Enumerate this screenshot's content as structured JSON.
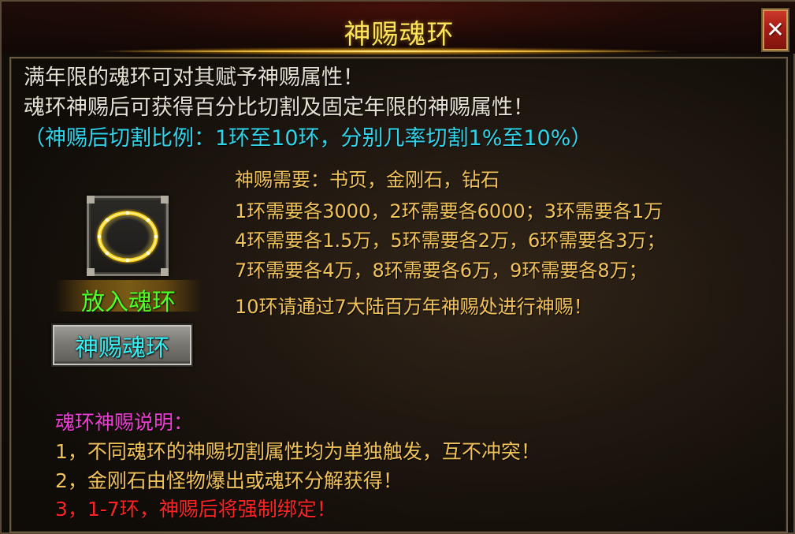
{
  "window": {
    "title": "神赐魂环",
    "close_label": "✕"
  },
  "intro": {
    "line1": "满年限的魂环可对其赋予神赐属性！",
    "line2": "魂环神赐后可获得百分比切割及固定年限的神赐属性！",
    "ratio": "（神赐后切割比例：1环至10环，分别几率切割1%至10%）"
  },
  "requirements": {
    "materials": "神赐需要：书页，金刚石，钻石",
    "row1": "1环需要各3000，2环需要各6000；3环需要各1万",
    "row2": "4环需要各1.5万，5环需要各2万，6环需要各3万；",
    "row3": "7环需要各4万，8环需要各6万，9环需要各8万；",
    "row4": "10环请通过7大陆百万年神赐处进行神赐！"
  },
  "slot": {
    "icon": "soul-ring-slot-icon",
    "label": "放入魂环"
  },
  "bestow_button": {
    "label": "神赐魂环"
  },
  "notes": {
    "heading": "魂环神赐说明：",
    "item1": "1，不同魂环的神赐切割属性均为单独触发，互不冲突！",
    "item2": "2，金刚石由怪物爆出或魂环分解获得！",
    "item3": "3，1-7环，神赐后将强制绑定！"
  },
  "colors": {
    "title": "#ffe45a",
    "intro": "#e6e0d2",
    "cyan": "#2fd4ea",
    "gold": "#f2c25a",
    "green": "#4dff28",
    "magenta": "#ee3ed3",
    "red": "#ff2424",
    "close": "#b01f16"
  }
}
